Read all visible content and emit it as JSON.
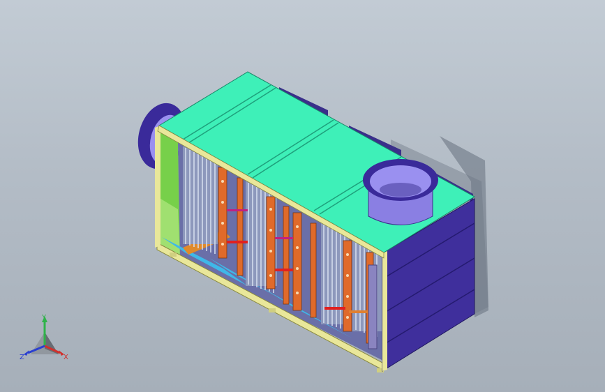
{
  "viewport": {
    "background_top": "#c2cbd4",
    "background_bottom": "#a6afb9"
  },
  "model": {
    "colors": {
      "top_panel": "#3ef0b8",
      "frame": "#e9e79a",
      "side_panel": "#3f2f9c",
      "duct": "#8a7fe3",
      "end_wall": "#77d04a",
      "base_plate": "#3fb8e8",
      "electrode_rail": "#e06a2a",
      "wire_grid": "#b8c4d8",
      "shadow": "#7d8794"
    }
  },
  "triad": {
    "x_label": "X",
    "y_label": "Y",
    "z_label": "Z",
    "x_color": "#d0302c",
    "y_color": "#2fb34a",
    "z_color": "#2a3fd0"
  }
}
